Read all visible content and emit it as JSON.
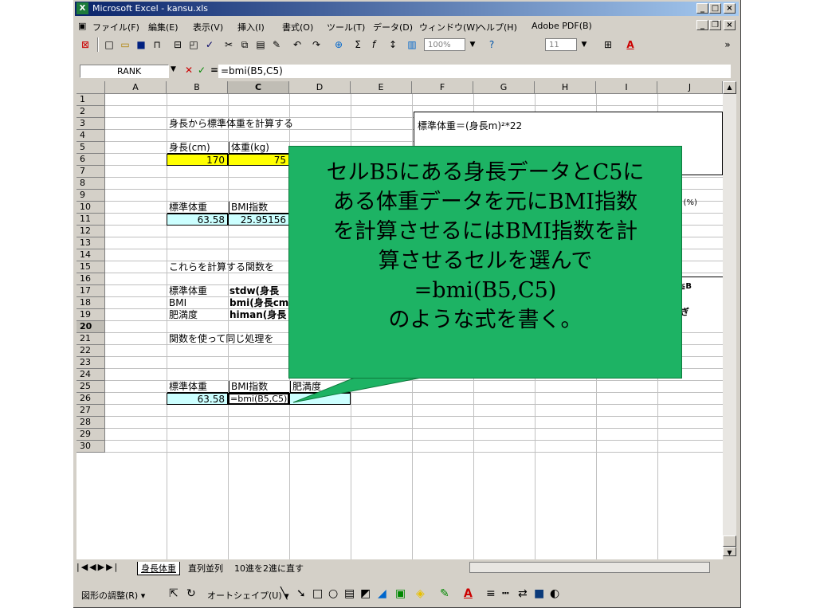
{
  "window": {
    "title": "Microsoft Excel - kansu.xls",
    "min": "_",
    "max": "□",
    "close": "×"
  },
  "menus": [
    "ファイル(F)",
    "編集(E)",
    "表示(V)",
    "挿入(I)",
    "書式(O)",
    "ツール(T)",
    "データ(D)",
    "ウィンドウ(W)",
    "ヘルプ(H)",
    "Adobe PDF(B)"
  ],
  "toolbar": {
    "zoom": "100%",
    "font_size": "11"
  },
  "formula_bar": {
    "name_box": "RANK",
    "cancel": "✕",
    "enter": "✓",
    "eq": "=",
    "formula": "=bmi(B5,C5)"
  },
  "columns": [
    "A",
    "B",
    "C",
    "D",
    "E",
    "F",
    "G",
    "H",
    "I",
    "J"
  ],
  "rows": [
    "1",
    "2",
    "3",
    "4",
    "5",
    "6",
    "7",
    "8",
    "9",
    "10",
    "11",
    "12",
    "13",
    "14",
    "15",
    "16",
    "17",
    "18",
    "19",
    "20",
    "21",
    "22",
    "23",
    "24",
    "25",
    "26",
    "27",
    "28",
    "29",
    "30"
  ],
  "cells": {
    "b2": "身長から標準体重を計算する",
    "b4": "身長(cm)",
    "c4": "体重(kg)",
    "b5": "170",
    "c5": "75",
    "b8": "標準体重",
    "c8": "BMI指数",
    "b9": "63.58",
    "c9": "25.95156",
    "b12": "これらを計算する関数を",
    "b13": "標準体重",
    "c13": "stdw(身長",
    "b14": "BMI",
    "c14": "bmi(身長cm",
    "b15": "肥満度",
    "c15": "himan(身長",
    "b17": "関数を使って同じ処理を",
    "b19": "標準体重",
    "c19": "BMI指数",
    "d19": "肥満度",
    "b20": "63.58",
    "c20": "=bmi(B5,C5)",
    "f2": "標準体重＝(身長m)²*22",
    "j8": "0 (%)",
    "j13": "4≦B",
    "j14": "すぎ"
  },
  "sheet_tabs": [
    "身長体重",
    "直列並列",
    "10進を2進に直す"
  ],
  "drawing_bar": {
    "draw": "図形の調整(R) ▾",
    "autoshape": "オートシェイプ(U) ▾"
  },
  "callout": {
    "lines": [
      "セルB5にある身長データとC5に",
      "ある体重データを元にBMI指数",
      "を計算させるにはBMI指数を計",
      "算させるセルを選んで",
      "=bmi(B5,C5)",
      "のような式を書く。"
    ]
  }
}
